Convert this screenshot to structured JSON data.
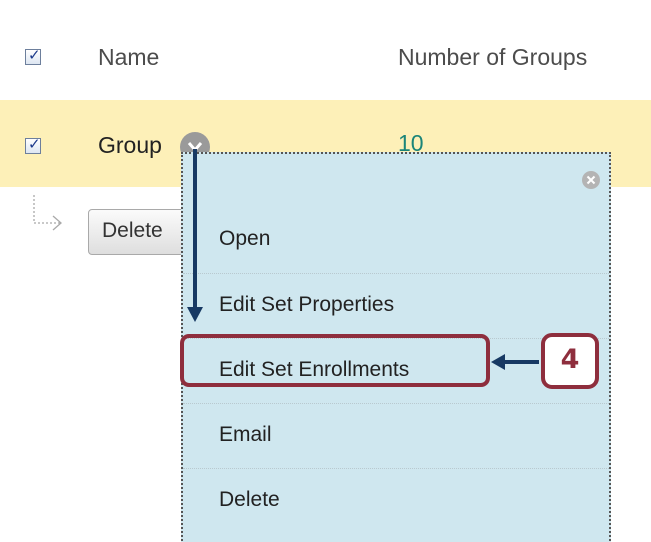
{
  "table": {
    "header": {
      "name_label": "Name",
      "count_label": "Number of Groups",
      "checked": true
    },
    "row": {
      "name": "Group",
      "count": "10",
      "checked": true
    }
  },
  "actions": {
    "delete_label": "Delete"
  },
  "context_menu": {
    "items": [
      {
        "label": "Open"
      },
      {
        "label": "Edit Set Properties"
      },
      {
        "label": "Edit Set Enrollments"
      },
      {
        "label": "Email"
      },
      {
        "label": "Delete"
      }
    ]
  },
  "annotation": {
    "step_number": "4",
    "highlight_color": "#8e2e3d",
    "arrow_color": "#173963"
  },
  "colors": {
    "row_highlight": "#fdf0b8",
    "menu_background": "#cfe7ef",
    "count_link": "#1b8579"
  },
  "icons": {
    "checkbox_checked": "check-icon",
    "row_menu": "chevron-down-icon",
    "menu_close": "close-icon",
    "action_bar": "corner-arrow-icon"
  }
}
